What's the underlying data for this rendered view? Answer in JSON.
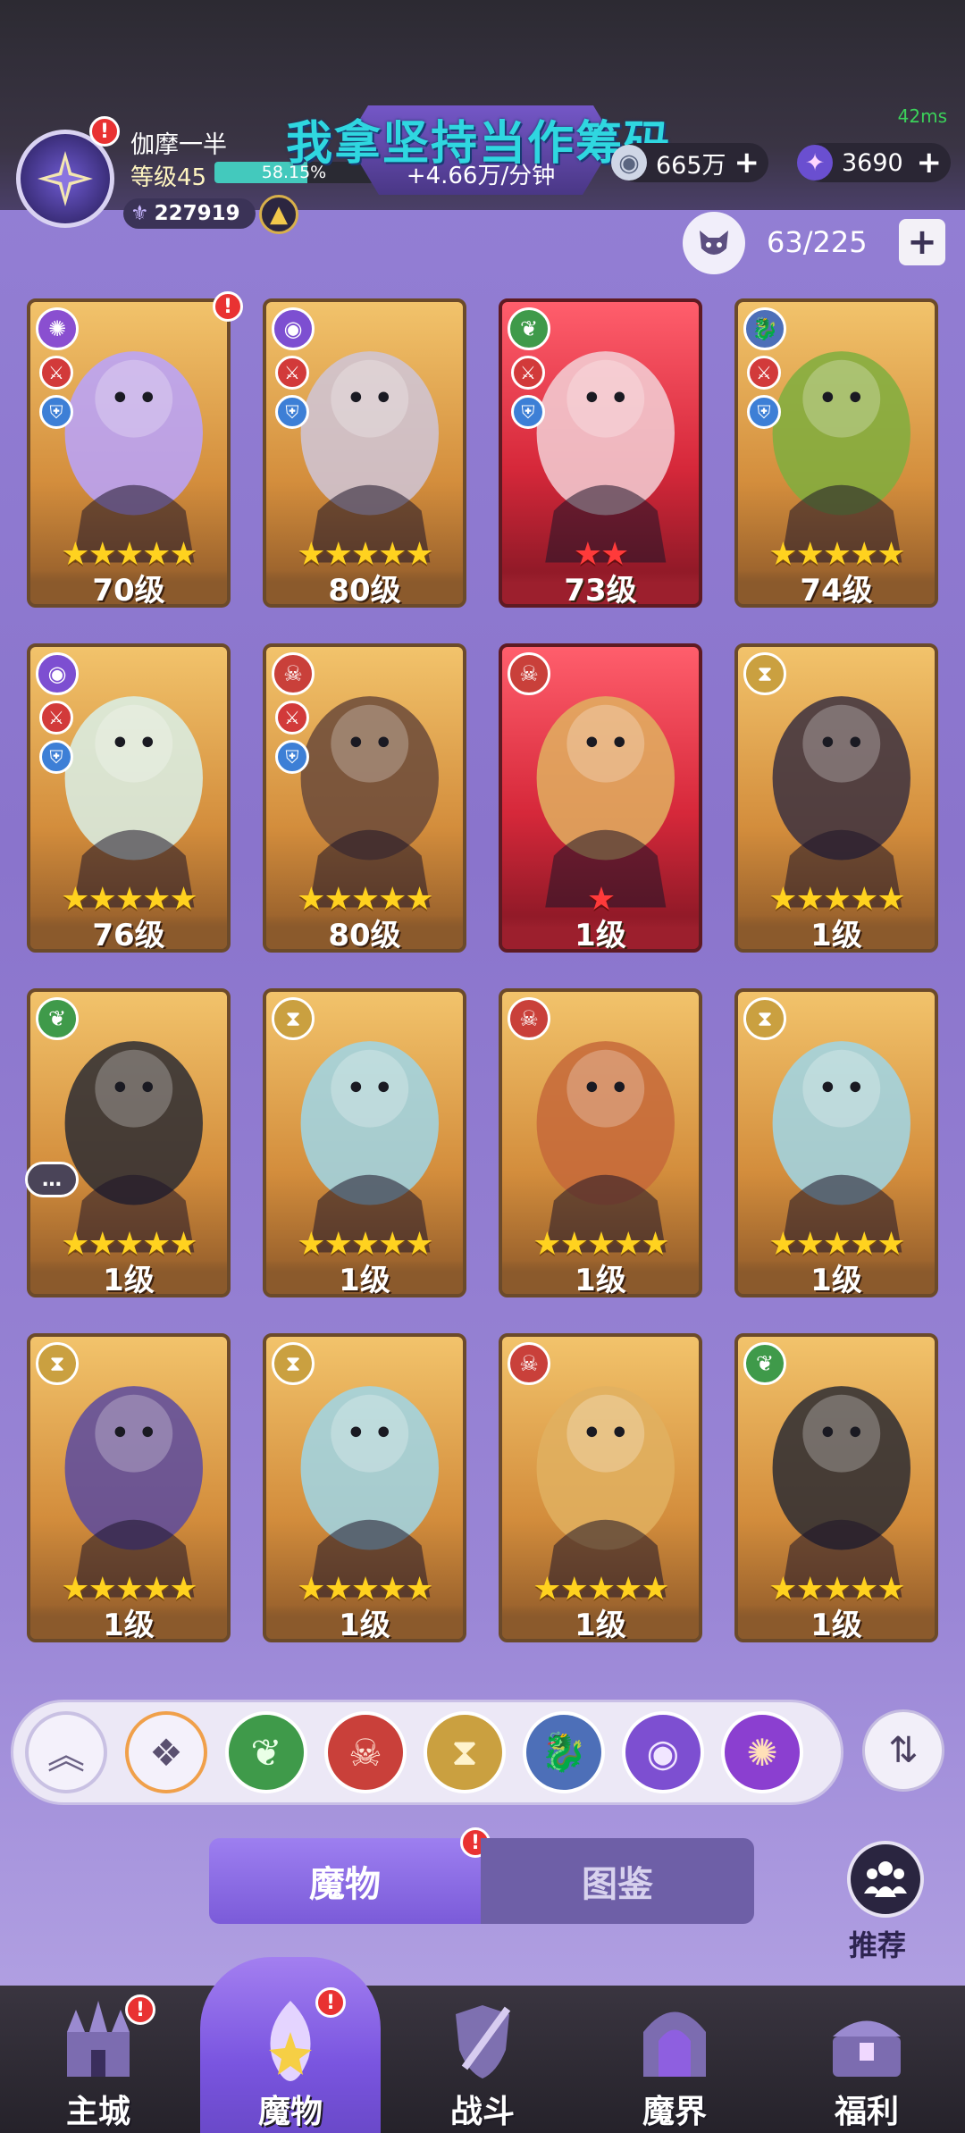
{
  "status": {
    "ping": "42ms"
  },
  "player": {
    "name": "伽摩一半",
    "level_label": "等级45",
    "xp_percent": 58.15,
    "xp_text": "58.15%",
    "power": "227919"
  },
  "income": {
    "rate": "+4.66万/分钟"
  },
  "overlay_caption": "我拿坚持当作筹码",
  "resources": [
    {
      "icon": "gem-coin-icon",
      "value": "665万"
    },
    {
      "icon": "star-crystal-icon",
      "value": "3690"
    }
  ],
  "collection": {
    "count": "63/225"
  },
  "cards": [
    {
      "level": "70级",
      "stars": 5,
      "star_color": "yellow",
      "frame": "gold"
    },
    {
      "level": "80级",
      "stars": 5,
      "star_color": "yellow",
      "frame": "gold"
    },
    {
      "level": "73级",
      "stars": 2,
      "star_color": "red",
      "frame": "red"
    },
    {
      "level": "74级",
      "stars": 5,
      "star_color": "yellow",
      "frame": "gold"
    },
    {
      "level": "76级",
      "stars": 5,
      "star_color": "yellow",
      "frame": "gold"
    },
    {
      "level": "80级",
      "stars": 5,
      "star_color": "yellow",
      "frame": "gold"
    },
    {
      "level": "1级",
      "stars": 1,
      "star_color": "red",
      "frame": "red"
    },
    {
      "level": "1级",
      "stars": 5,
      "star_color": "yellow",
      "frame": "gold"
    },
    {
      "level": "1级",
      "stars": 5,
      "star_color": "yellow",
      "frame": "gold"
    },
    {
      "level": "1级",
      "stars": 5,
      "star_color": "yellow",
      "frame": "gold"
    },
    {
      "level": "1级",
      "stars": 5,
      "star_color": "yellow",
      "frame": "gold"
    },
    {
      "level": "1级",
      "stars": 5,
      "star_color": "yellow",
      "frame": "gold"
    },
    {
      "level": "1级",
      "stars": 5,
      "star_color": "yellow",
      "frame": "gold"
    },
    {
      "level": "1级",
      "stars": 5,
      "star_color": "yellow",
      "frame": "gold"
    },
    {
      "level": "1级",
      "stars": 5,
      "star_color": "yellow",
      "frame": "gold"
    },
    {
      "level": "1级",
      "stars": 5,
      "star_color": "yellow",
      "frame": "gold"
    }
  ],
  "tabs": {
    "monsters": "魔物",
    "codex": "图鉴"
  },
  "recommend": {
    "label": "推荐"
  },
  "nav": [
    {
      "label": "主城"
    },
    {
      "label": "魔物"
    },
    {
      "label": "战斗"
    },
    {
      "label": "魔界"
    },
    {
      "label": "福利"
    }
  ]
}
